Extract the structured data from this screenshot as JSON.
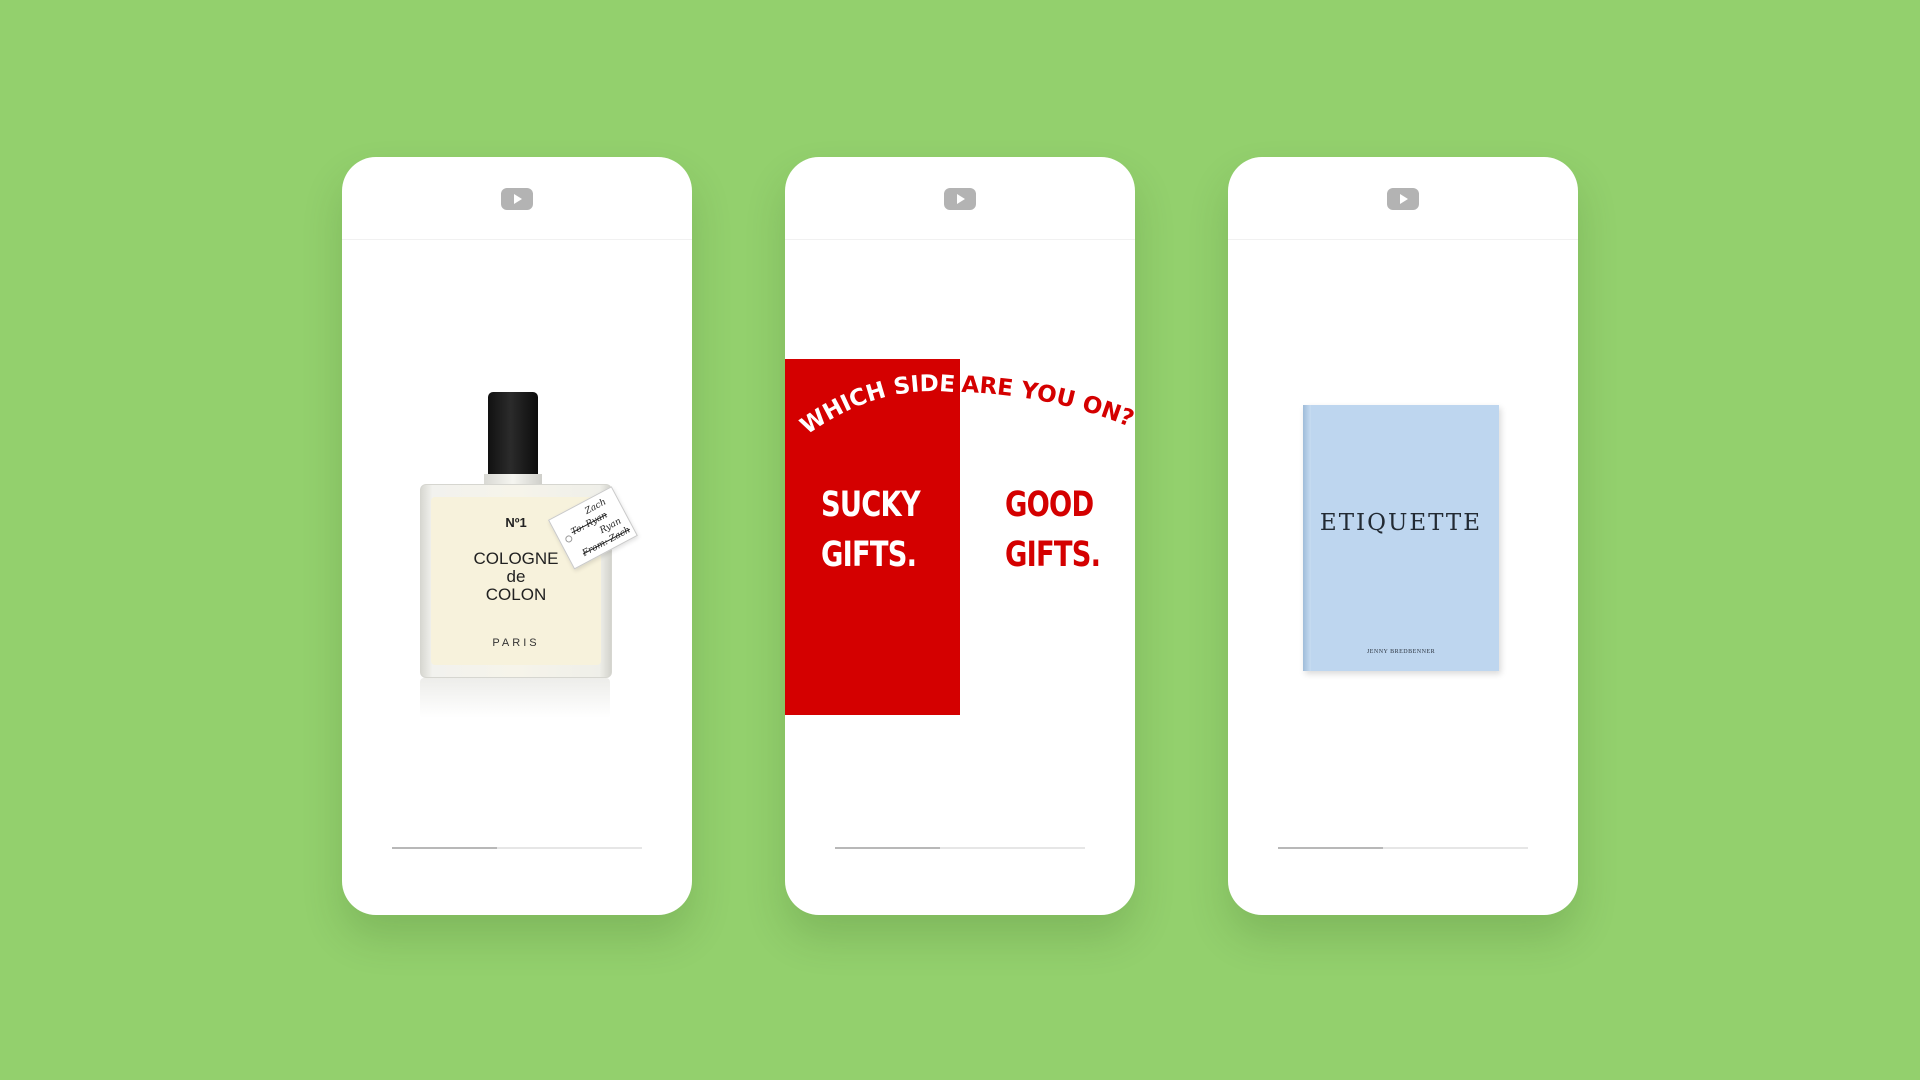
{
  "background_color": "#93d06d",
  "accent_red": "#d40000",
  "book_color": "#bed6ef",
  "phones": [
    {
      "top_icon": "youtube-play-icon",
      "progress": 0.42,
      "cologne": {
        "number": "Nº1",
        "line1": "COLOGNE",
        "line2": "de",
        "line3": "COLON",
        "city": "PARIS",
        "tag": {
          "line1": "Zach",
          "line2": "To: Ryan",
          "line3": "Ryan",
          "line4": "From: Zach"
        }
      }
    },
    {
      "top_icon": "youtube-play-icon",
      "progress": 0.42,
      "question_left": "WHICH SIDE",
      "question_right": "ARE YOU ON?",
      "left_line1": "SUCKY",
      "left_line2": "GIFTS.",
      "right_line1": "GOOD",
      "right_line2": "GIFTS."
    },
    {
      "top_icon": "youtube-play-icon",
      "progress": 0.42,
      "book_title": "ETIQUETTE",
      "book_author": "JENNY BREDBENNER"
    }
  ]
}
